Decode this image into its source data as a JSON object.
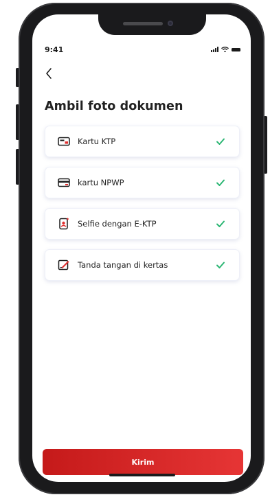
{
  "status_bar": {
    "time": "9:41"
  },
  "header": {
    "title": "Ambil foto dokumen"
  },
  "documents": [
    {
      "label": "Kartu KTP",
      "icon": "id-card-icon",
      "status": "done"
    },
    {
      "label": "kartu NPWP",
      "icon": "card-icon",
      "status": "done"
    },
    {
      "label": "Selfie dengan E-KTP",
      "icon": "selfie-phone-icon",
      "status": "done"
    },
    {
      "label": "Tanda tangan di kertas",
      "icon": "signature-icon",
      "status": "done"
    }
  ],
  "footer": {
    "submit_label": "Kirim"
  },
  "colors": {
    "accent_red": "#d62626",
    "check_green": "#2bb673"
  }
}
